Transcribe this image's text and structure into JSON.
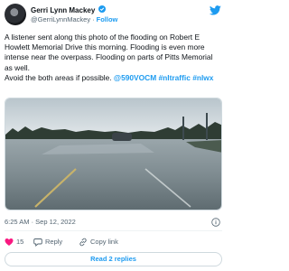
{
  "author": {
    "name": "Gerri Lynn Mackey",
    "handle": "@GerriLynnMackey",
    "separator": "·",
    "follow_label": "Follow"
  },
  "tweet": {
    "text": "A listener sent along this photo of the flooding on Robert E Howlett Memorial Drive this morning. Flooding is even more intense near the overpass. Flooding on parts of Pitts Memorial as well.",
    "text2": "Avoid the both areas if possible.",
    "mentions_and_tags": "@590VOCM #nltraffic #nlwx",
    "timestamp": "6:25 AM · Sep 12, 2022"
  },
  "actions": {
    "like_count": "15",
    "reply_label": "Reply",
    "copy_link_label": "Copy link"
  },
  "replies_button_label": "Read 2 replies",
  "icons": {
    "verified": "verified-badge-icon",
    "logo": "twitter-bird-icon",
    "like": "heart-icon",
    "reply": "speech-bubble-icon",
    "copy": "link-icon",
    "info": "info-icon"
  },
  "colors": {
    "accent": "#1d9bf0",
    "text": "#0f1419",
    "muted": "#536471",
    "border": "#cfd9de",
    "like": "#f91880"
  }
}
